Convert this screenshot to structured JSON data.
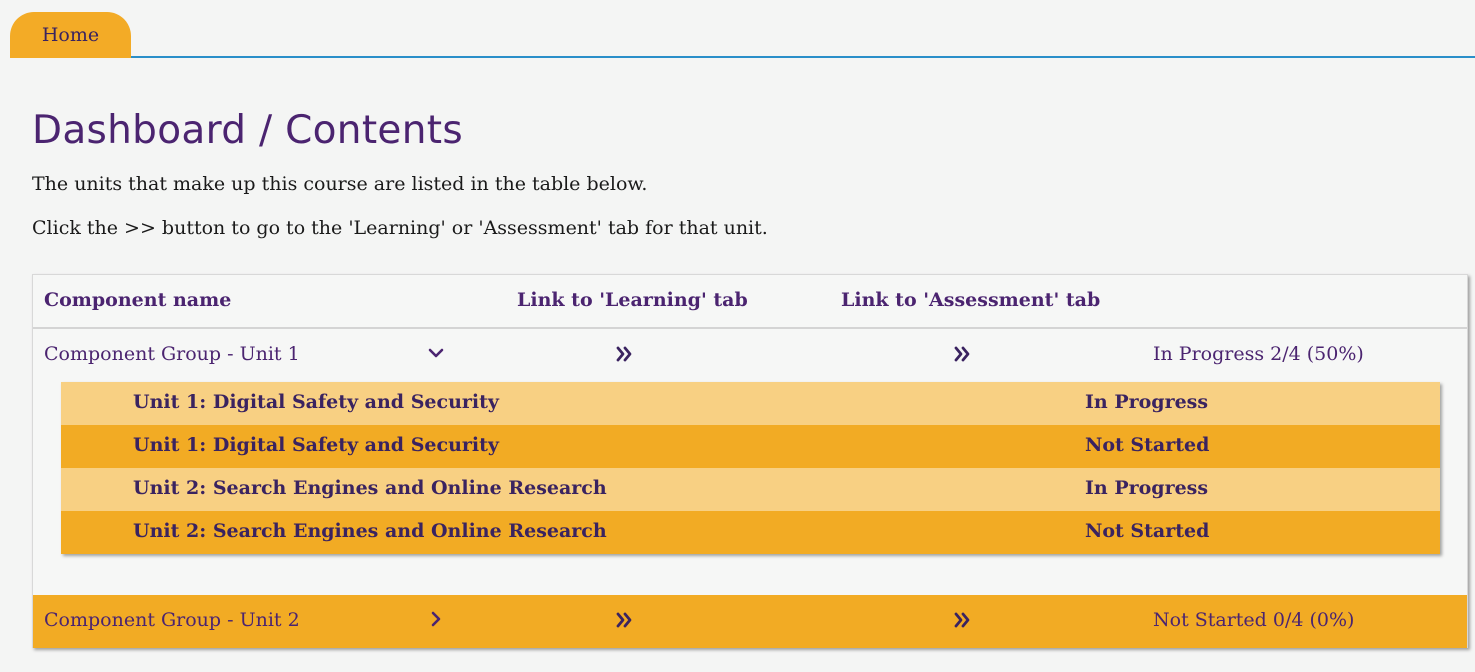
{
  "tabs": [
    {
      "label": "Home",
      "active": true
    }
  ],
  "page": {
    "title": "Dashboard / Contents",
    "intro_line1": "The units that make up this course are listed in the table below.",
    "intro_line2": "Click the >> button to go to the 'Learning' or 'Assessment' tab for that unit."
  },
  "table": {
    "headers": {
      "component_name": "Component name",
      "learning": "Link to 'Learning' tab",
      "assessment": "Link to 'Assessment' tab"
    },
    "groups": [
      {
        "name": "Component Group - Unit 1",
        "expanded": true,
        "status": "In Progress 2/4 (50%)",
        "units": [
          {
            "name": "Unit 1: Digital Safety and Security",
            "status": "In Progress"
          },
          {
            "name": "Unit 1: Digital Safety and Security",
            "status": "Not Started"
          },
          {
            "name": "Unit 2: Search Engines and Online Research",
            "status": "In Progress"
          },
          {
            "name": "Unit 2: Search Engines and Online Research",
            "status": "Not Started"
          }
        ]
      },
      {
        "name": "Component Group - Unit 2",
        "expanded": false,
        "status": "Not Started 0/4 (0%)",
        "units": []
      }
    ]
  },
  "icons": {
    "expand": "chevron-down-icon",
    "collapse": "chevron-right-icon",
    "go": "double-chevron-right-icon"
  },
  "colors": {
    "accent_orange": "#f2ab24",
    "light_orange": "#f8d083",
    "purple": "#4b2470",
    "tab_underline": "#2a8fc9"
  }
}
